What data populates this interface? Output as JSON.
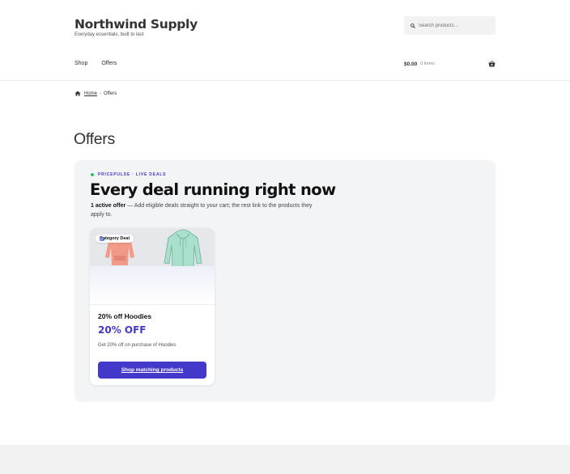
{
  "site": {
    "title": "Northwind Supply",
    "tagline": "Everyday essentials, built to last"
  },
  "search": {
    "placeholder": "Search products…",
    "icon": "search-icon"
  },
  "nav": {
    "items": [
      {
        "label": "Shop"
      },
      {
        "label": "Offers"
      }
    ]
  },
  "cart": {
    "amount": "$0.00",
    "count": "0 items",
    "icon": "basket-icon"
  },
  "breadcrumb": {
    "home": "Home",
    "separator": "›",
    "current": "Offers"
  },
  "page": {
    "title": "Offers"
  },
  "offers": {
    "eyebrow": "PRICEPULSE · LIVE DEALS",
    "headline": "Every deal running right now",
    "summary_bold": "1 active offer",
    "summary_text": " — Add eligible deals straight to your cart; the rest link to the products they apply to.",
    "accent_color": "#4338ca",
    "live_dot_color": "#22c55e",
    "deals": [
      {
        "badge": "Category Deal",
        "name": "20% off Hoodies",
        "amount": "20% OFF",
        "description": "Get 20% off on purchase of Hoodies",
        "cta": "Shop matching products"
      }
    ]
  }
}
